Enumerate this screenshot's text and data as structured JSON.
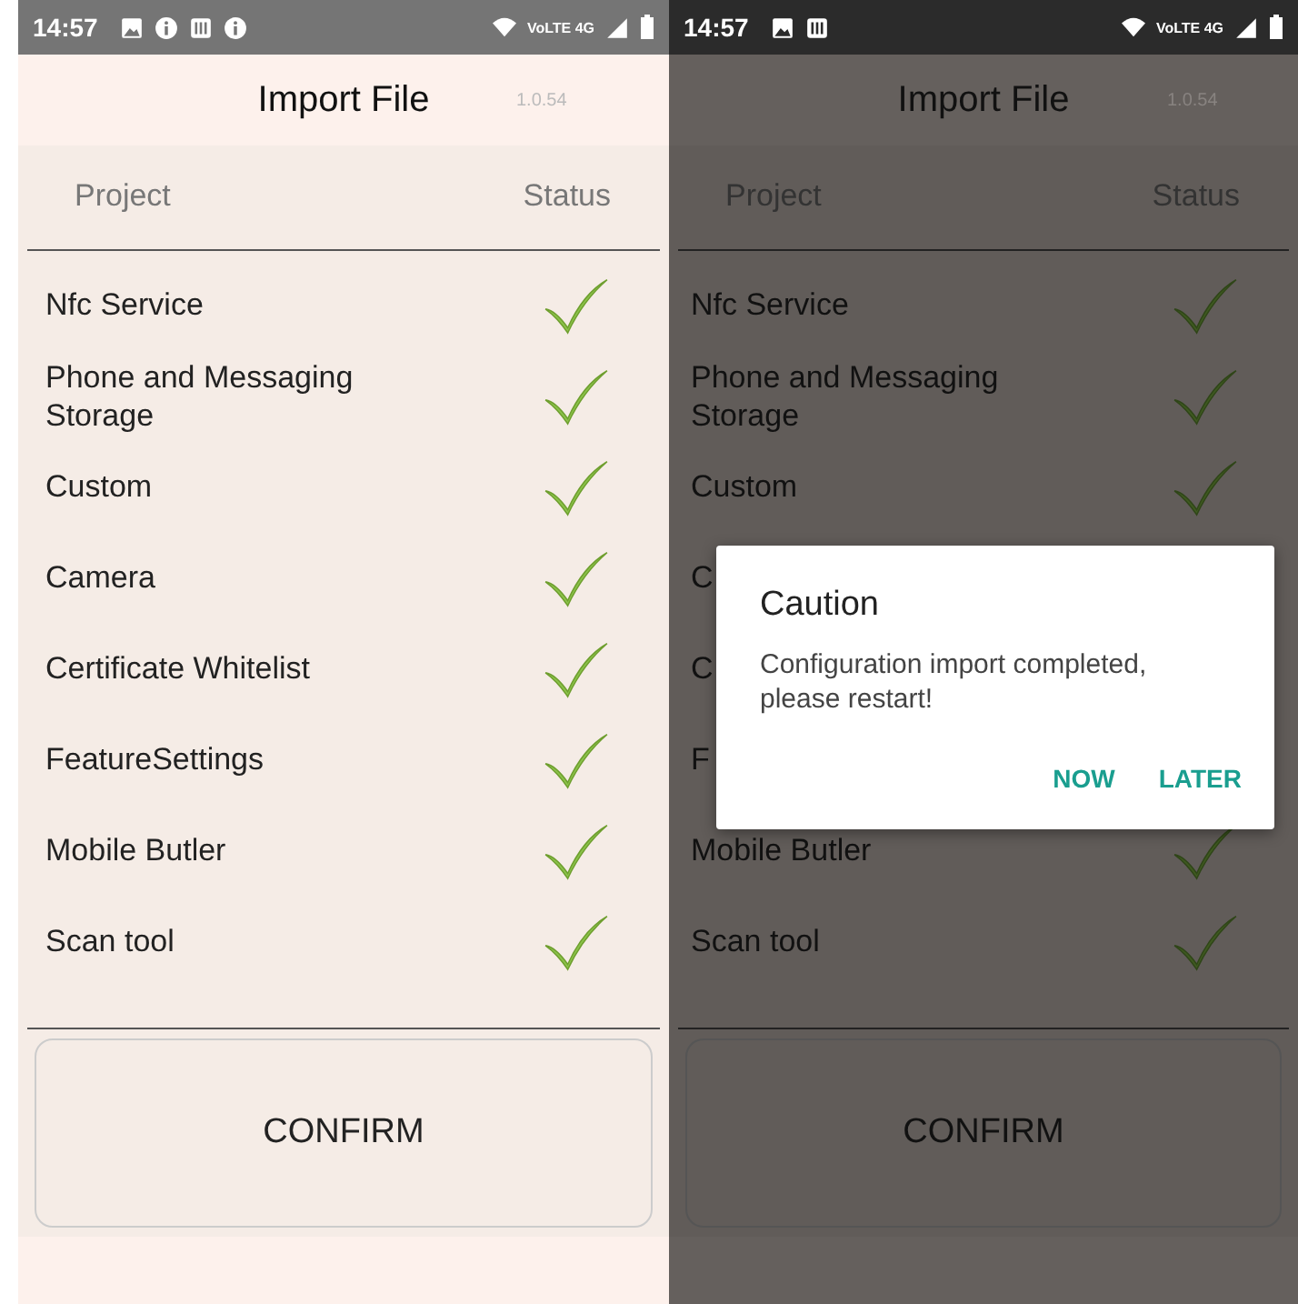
{
  "screens": [
    {
      "status_bar": {
        "time": "14:57",
        "notifications": [
          {
            "kind": "image"
          },
          {
            "kind": "info"
          },
          {
            "kind": "sim"
          },
          {
            "kind": "info"
          }
        ],
        "network": "VoLTE 4G"
      },
      "title": "Import File",
      "version": "1.0.54",
      "columns": [
        "Project",
        "Status"
      ],
      "rows": [
        {
          "label": "Nfc Service",
          "imported": true
        },
        {
          "label": "Phone and Messaging Storage",
          "imported": true
        },
        {
          "label": "Custom",
          "imported": true
        },
        {
          "label": "Camera",
          "imported": true
        },
        {
          "label": "Certificate Whitelist",
          "imported": true
        },
        {
          "label": "FeatureSettings",
          "imported": true
        },
        {
          "label": "Mobile Butler",
          "imported": true
        },
        {
          "label": "Scan tool",
          "imported": true
        }
      ],
      "confirm": "CONFIRM"
    },
    {
      "status_bar": {
        "time": "14:57",
        "notifications": [
          {
            "kind": "image"
          },
          {
            "kind": "sim"
          }
        ],
        "network": "VoLTE 4G"
      },
      "title": "Import File",
      "version": "1.0.54",
      "columns": [
        "Project",
        "Status"
      ],
      "rows": [
        {
          "label": "Nfc Service",
          "imported": true
        },
        {
          "label": "Phone and Messaging Storage",
          "imported": true
        },
        {
          "label": "Custom",
          "imported": true
        },
        {
          "label": "C"
        },
        {
          "label": "C"
        },
        {
          "label": "F"
        },
        {
          "label": "Mobile Butler",
          "imported": true
        },
        {
          "label": "Scan tool",
          "imported": true
        }
      ],
      "confirm": "CONFIRM",
      "dialog": {
        "title": "Caution",
        "message": "Configuration import completed, please restart!",
        "buttons": [
          "NOW",
          "LATER"
        ]
      }
    }
  ]
}
